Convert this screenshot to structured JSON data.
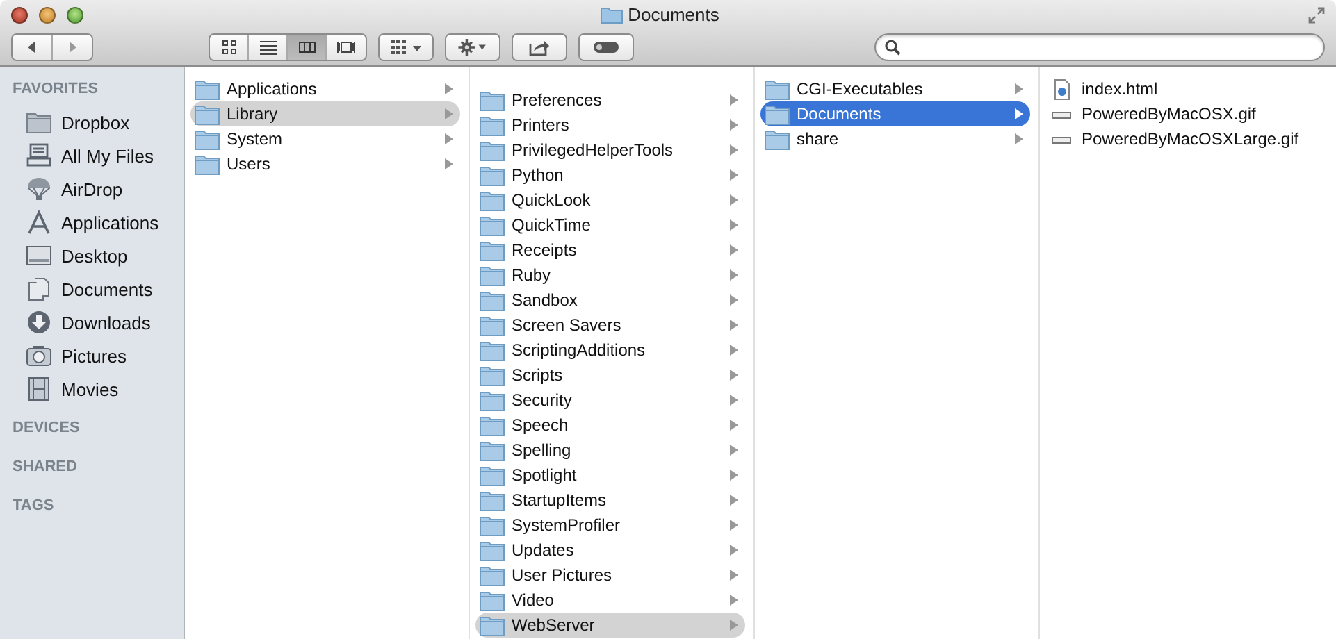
{
  "window": {
    "title": "Documents"
  },
  "toolbar": {
    "views": [
      {
        "kind": "icons",
        "selected": false
      },
      {
        "kind": "list",
        "selected": false
      },
      {
        "kind": "columns",
        "selected": true
      },
      {
        "kind": "coverflow",
        "selected": false
      }
    ]
  },
  "sidebar": {
    "sections": [
      {
        "title": "FAVORITES",
        "items": [
          {
            "label": "Dropbox",
            "kind": "folder"
          },
          {
            "label": "All My Files",
            "kind": "files"
          },
          {
            "label": "AirDrop",
            "kind": "airdrop"
          },
          {
            "label": "Applications",
            "kind": "apps"
          },
          {
            "label": "Desktop",
            "kind": "desktop"
          },
          {
            "label": "Documents",
            "kind": "document"
          },
          {
            "label": "Downloads",
            "kind": "download"
          },
          {
            "label": "Pictures",
            "kind": "camera"
          },
          {
            "label": "Movies",
            "kind": "film"
          }
        ]
      },
      {
        "title": "DEVICES"
      },
      {
        "title": "SHARED"
      },
      {
        "title": "TAGS"
      }
    ]
  },
  "columns": [
    {
      "focused": false,
      "items": [
        {
          "name": "Applications",
          "kind": "folder",
          "selected": false,
          "has_children": true
        },
        {
          "name": "Library",
          "kind": "folder",
          "selected": true,
          "has_children": true
        },
        {
          "name": "System",
          "kind": "folder",
          "selected": false,
          "has_children": true
        },
        {
          "name": "Users",
          "kind": "folder",
          "selected": false,
          "has_children": true
        }
      ]
    },
    {
      "focused": false,
      "items": [
        {
          "name": "Preferences",
          "kind": "folder",
          "selected": false,
          "has_children": true
        },
        {
          "name": "Printers",
          "kind": "folder",
          "selected": false,
          "has_children": true
        },
        {
          "name": "PrivilegedHelperTools",
          "kind": "folder",
          "selected": false,
          "has_children": true
        },
        {
          "name": "Python",
          "kind": "folder",
          "selected": false,
          "has_children": true
        },
        {
          "name": "QuickLook",
          "kind": "folder",
          "selected": false,
          "has_children": true
        },
        {
          "name": "QuickTime",
          "kind": "folder",
          "selected": false,
          "has_children": true
        },
        {
          "name": "Receipts",
          "kind": "folder",
          "selected": false,
          "has_children": true
        },
        {
          "name": "Ruby",
          "kind": "folder",
          "selected": false,
          "has_children": true
        },
        {
          "name": "Sandbox",
          "kind": "folder",
          "selected": false,
          "has_children": true
        },
        {
          "name": "Screen Savers",
          "kind": "folder",
          "selected": false,
          "has_children": true
        },
        {
          "name": "ScriptingAdditions",
          "kind": "folder",
          "selected": false,
          "has_children": true
        },
        {
          "name": "Scripts",
          "kind": "folder",
          "selected": false,
          "has_children": true
        },
        {
          "name": "Security",
          "kind": "folder",
          "selected": false,
          "has_children": true
        },
        {
          "name": "Speech",
          "kind": "folder",
          "selected": false,
          "has_children": true
        },
        {
          "name": "Spelling",
          "kind": "folder",
          "selected": false,
          "has_children": true
        },
        {
          "name": "Spotlight",
          "kind": "folder",
          "selected": false,
          "has_children": true
        },
        {
          "name": "StartupItems",
          "kind": "folder",
          "selected": false,
          "has_children": true
        },
        {
          "name": "SystemProfiler",
          "kind": "folder",
          "selected": false,
          "has_children": true
        },
        {
          "name": "Updates",
          "kind": "folder",
          "selected": false,
          "has_children": true
        },
        {
          "name": "User Pictures",
          "kind": "folder",
          "selected": false,
          "has_children": true
        },
        {
          "name": "Video",
          "kind": "folder",
          "selected": false,
          "has_children": true
        },
        {
          "name": "WebServer",
          "kind": "folder",
          "selected": true,
          "has_children": true
        }
      ]
    },
    {
      "focused": true,
      "items": [
        {
          "name": "CGI-Executables",
          "kind": "folder",
          "selected": false,
          "has_children": true
        },
        {
          "name": "Documents",
          "kind": "folder",
          "selected": true,
          "has_children": true
        },
        {
          "name": "share",
          "kind": "folder",
          "selected": false,
          "has_children": true
        }
      ]
    },
    {
      "items": [
        {
          "name": "index.html",
          "kind": "html",
          "selected": false,
          "has_children": false
        },
        {
          "name": "PoweredByMacOSX.gif",
          "kind": "image",
          "selected": false,
          "has_children": false
        },
        {
          "name": "PoweredByMacOSXLarge.gif",
          "kind": "image",
          "selected": false,
          "has_children": false
        }
      ]
    }
  ]
}
